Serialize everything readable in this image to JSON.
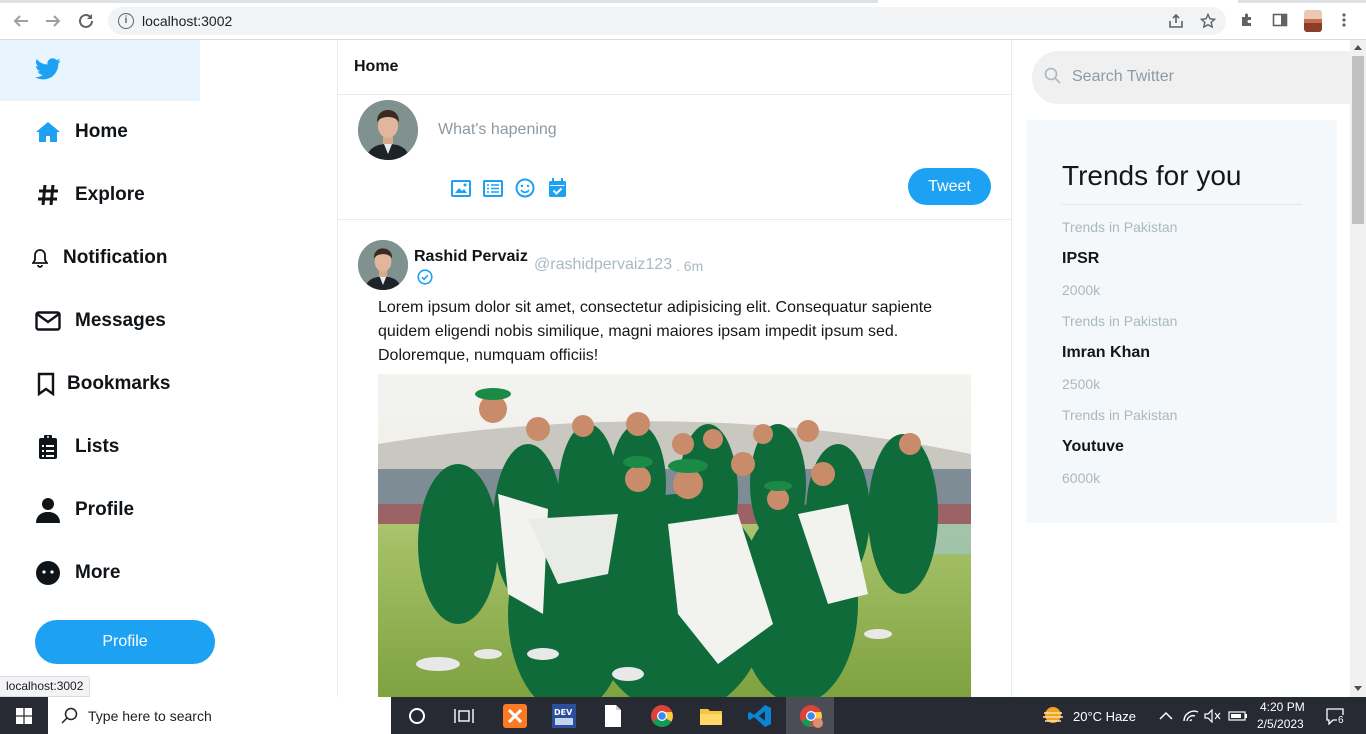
{
  "browser": {
    "url": "localhost:3002",
    "status_url": "localhost:3002"
  },
  "sidebar": {
    "items": [
      {
        "label": "Home",
        "icon": "home-icon"
      },
      {
        "label": "Explore",
        "icon": "hashtag-icon"
      },
      {
        "label": "Notification",
        "icon": "bell-icon"
      },
      {
        "label": "Messages",
        "icon": "envelope-icon"
      },
      {
        "label": "Bookmarks",
        "icon": "bookmark-icon"
      },
      {
        "label": "Lists",
        "icon": "clipboard-list-icon"
      },
      {
        "label": "Profile",
        "icon": "user-icon"
      },
      {
        "label": "More",
        "icon": "more-circle-icon"
      }
    ],
    "profile_button": "Profile"
  },
  "feed": {
    "header": "Home",
    "composer_placeholder": "What's hapening",
    "tweet_button": "Tweet",
    "post": {
      "name": "Rashid Pervaiz",
      "handle": "@rashidpervaiz123",
      "time": ". 6m",
      "text": "Lorem ipsum dolor sit amet, consectetur adipisicing elit. Consequatur sapiente quidem eligendi nobis similique, magni maiores ipsam impedit ipsum sed. Doloremque, numquam officiis!"
    }
  },
  "right": {
    "search_placeholder": "Search Twitter",
    "trends_title": "Trends for you",
    "trends": [
      {
        "location": "Trends in Pakistan",
        "name": "IPSR",
        "count": "2000k"
      },
      {
        "location": "Trends in Pakistan",
        "name": "Imran Khan",
        "count": "2500k"
      },
      {
        "location": "Trends in Pakistan",
        "name": "Youtuve",
        "count": "6000k"
      }
    ]
  },
  "taskbar": {
    "search": "Type here to search",
    "weather": "20°C  Haze",
    "time": "4:20 PM",
    "date": "2/5/2023",
    "notifications": "6"
  },
  "colors": {
    "accent": "#1da1f2",
    "logo_bg": "#e8f5fe",
    "trends_bg": "#f5f8fa"
  }
}
